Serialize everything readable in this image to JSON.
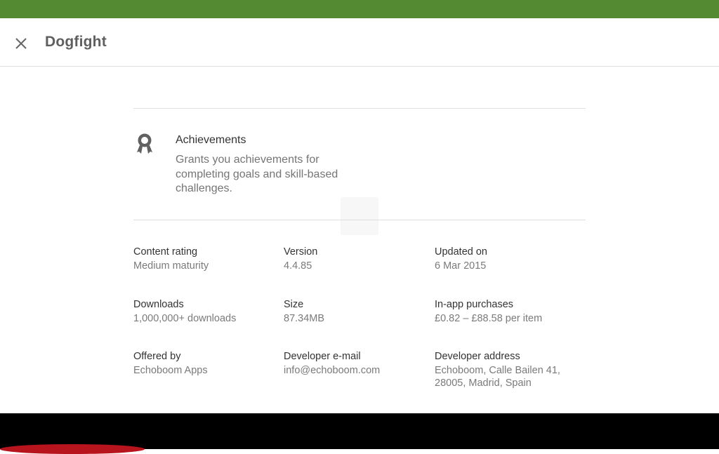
{
  "app_bar": {
    "title": "Dogfight",
    "close_icon": "close-icon"
  },
  "achievements": {
    "icon": "award-ribbon-icon",
    "title": "Achievements",
    "description": "Grants you achievements for completing goals and skill-based challenges."
  },
  "details": [
    {
      "key": "content_rating",
      "label": "Content rating",
      "value": "Medium maturity"
    },
    {
      "key": "version",
      "label": "Version",
      "value": "4.4.85"
    },
    {
      "key": "updated_on",
      "label": "Updated on",
      "value": "6 Mar 2015"
    },
    {
      "key": "downloads",
      "label": "Downloads",
      "value": "1,000,000+ downloads"
    },
    {
      "key": "size",
      "label": "Size",
      "value": "87.34MB"
    },
    {
      "key": "in_app_purchases",
      "label": "In-app purchases",
      "value": "£0.82 – £88.58 per item"
    },
    {
      "key": "offered_by",
      "label": "Offered by",
      "value": "Echoboom Apps"
    },
    {
      "key": "developer_email",
      "label": "Developer e-mail",
      "value": "info@echoboom.com"
    },
    {
      "key": "developer_address",
      "label": "Developer address",
      "value": "Echoboom, Calle Bailen 41,\n28005, Madrid, Spain"
    }
  ],
  "colors": {
    "status_bar": "#548a31",
    "title_text": "#5f5f5f",
    "label_text": "#333333",
    "value_text": "#7a7a7a"
  }
}
